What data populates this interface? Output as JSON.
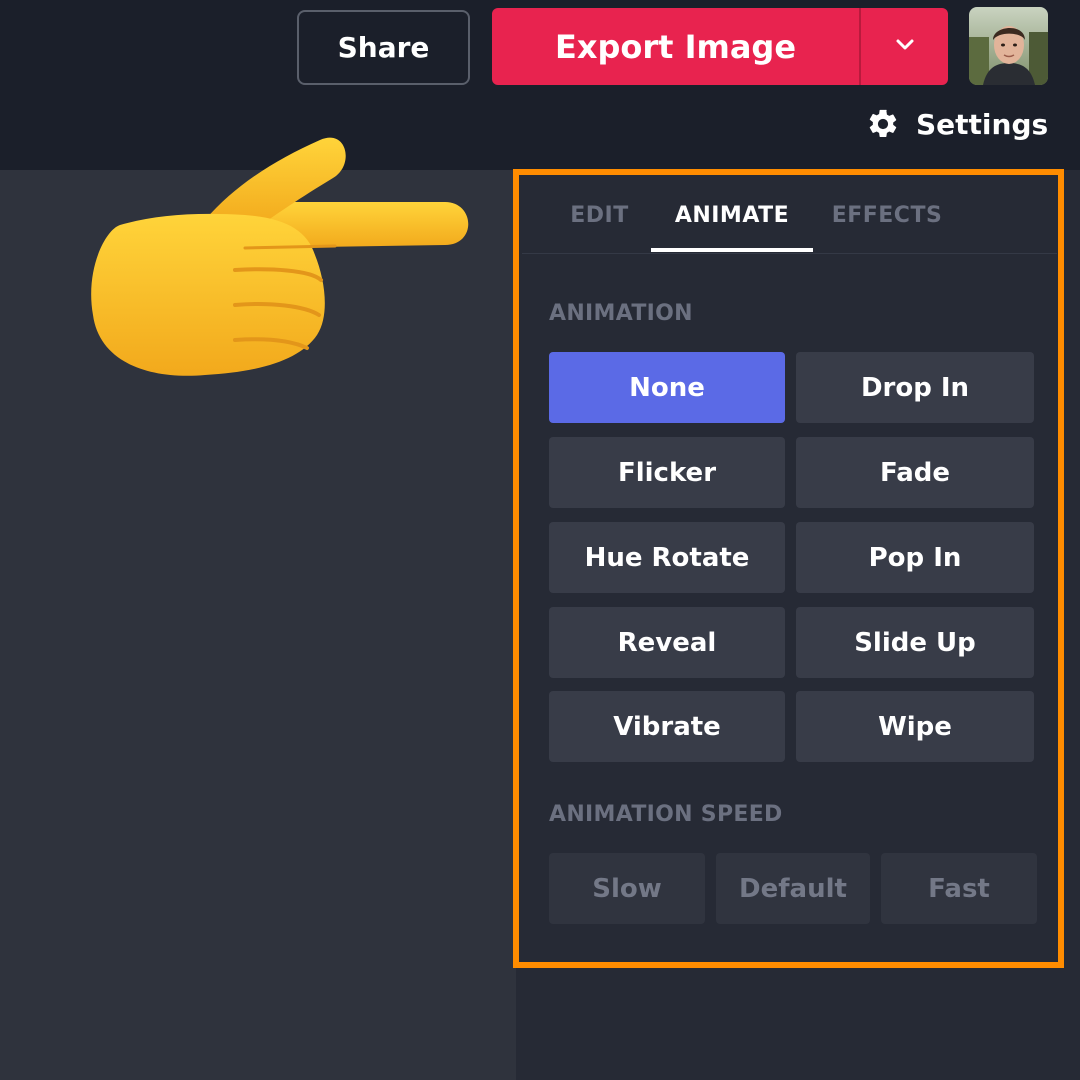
{
  "header": {
    "share_label": "Share",
    "export_label": "Export Image",
    "export_caret_icon": "chevron-down-icon",
    "avatar_icon": "user-avatar",
    "settings_label": "Settings",
    "settings_icon": "gear-icon"
  },
  "overlay": {
    "pointer_icon": "pointing-hand-icon",
    "highlight_color": "#ff8c00"
  },
  "panel": {
    "tabs": [
      {
        "label": "EDIT",
        "active": false
      },
      {
        "label": "ANIMATE",
        "active": true
      },
      {
        "label": "EFFECTS",
        "active": false
      }
    ],
    "animation_heading": "ANIMATION",
    "animations": [
      {
        "label": "None",
        "selected": true
      },
      {
        "label": "Drop In",
        "selected": false
      },
      {
        "label": "Flicker",
        "selected": false
      },
      {
        "label": "Fade",
        "selected": false
      },
      {
        "label": "Hue Rotate",
        "selected": false
      },
      {
        "label": "Pop In",
        "selected": false
      },
      {
        "label": "Reveal",
        "selected": false
      },
      {
        "label": "Slide Up",
        "selected": false
      },
      {
        "label": "Vibrate",
        "selected": false
      },
      {
        "label": "Wipe",
        "selected": false
      }
    ],
    "speed_heading": "ANIMATION SPEED",
    "speeds": [
      {
        "label": "Slow"
      },
      {
        "label": "Default"
      },
      {
        "label": "Fast"
      }
    ]
  },
  "colors": {
    "accent_export": "#e8234f",
    "selected_animation": "#5b6ae6",
    "topbar_bg": "#1b1f2a",
    "panel_bg": "#262a35"
  }
}
